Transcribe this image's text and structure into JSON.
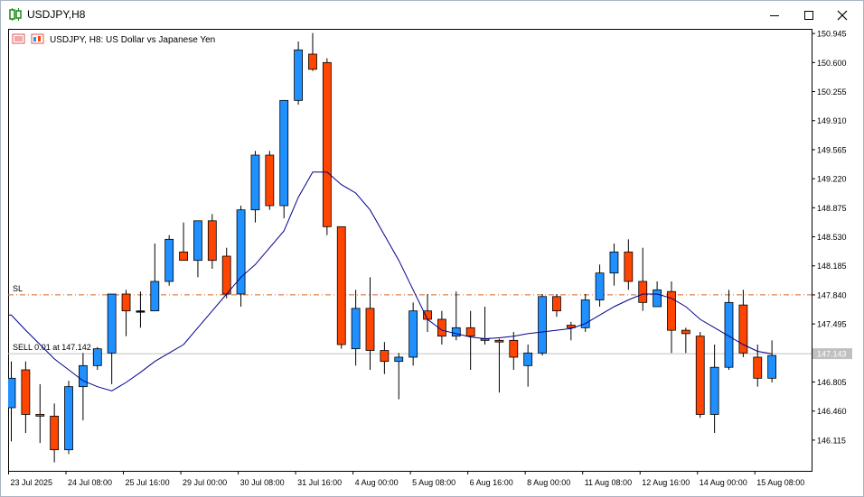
{
  "window": {
    "title": "USDJPY,H8"
  },
  "chart_header": {
    "text": "USDJPY, H8:  US Dollar vs Japanese Yen"
  },
  "levels": {
    "sl_label": "SL",
    "sl_price": 147.84,
    "sell_label": "SELL 0.01 at 147.142",
    "sell_price": 147.142,
    "current_price_label": "147.143"
  },
  "colors": {
    "bull": "#1e90ff",
    "bear": "#ff4500",
    "ma": "#00008b",
    "sl_line": "#d26a2a",
    "sell_line": "#c0c0c0"
  },
  "chart_data": {
    "type": "candlestick",
    "ylim": [
      145.75,
      151.0
    ],
    "y_ticks": [
      "150.945",
      "150.600",
      "150.255",
      "149.910",
      "149.565",
      "149.220",
      "148.875",
      "148.530",
      "148.185",
      "147.840",
      "147.495",
      "146.805",
      "146.460",
      "146.115"
    ],
    "x_ticks": [
      {
        "label": "23 Jul 2025",
        "index": 0
      },
      {
        "label": "24 Jul 08:00",
        "index": 4
      },
      {
        "label": "25 Jul 16:00",
        "index": 8
      },
      {
        "label": "29 Jul 00:00",
        "index": 12
      },
      {
        "label": "30 Jul 08:00",
        "index": 16
      },
      {
        "label": "31 Jul 16:00",
        "index": 20
      },
      {
        "label": "4 Aug 00:00",
        "index": 24
      },
      {
        "label": "5 Aug 08:00",
        "index": 28
      },
      {
        "label": "6 Aug 16:00",
        "index": 32
      },
      {
        "label": "8 Aug 00:00",
        "index": 36
      },
      {
        "label": "11 Aug 08:00",
        "index": 40
      },
      {
        "label": "12 Aug 16:00",
        "index": 44
      },
      {
        "label": "14 Aug 00:00",
        "index": 48
      },
      {
        "label": "15 Aug 08:00",
        "index": 52
      }
    ],
    "candles": [
      {
        "o": 146.5,
        "h": 147.05,
        "l": 146.1,
        "c": 146.85
      },
      {
        "o": 146.95,
        "h": 147.05,
        "l": 146.2,
        "c": 146.42
      },
      {
        "o": 146.42,
        "h": 146.78,
        "l": 146.08,
        "c": 146.4
      },
      {
        "o": 146.4,
        "h": 146.55,
        "l": 145.85,
        "c": 146.0
      },
      {
        "o": 146.0,
        "h": 146.82,
        "l": 145.95,
        "c": 146.75
      },
      {
        "o": 146.75,
        "h": 147.15,
        "l": 146.35,
        "c": 147.0
      },
      {
        "o": 147.0,
        "h": 147.22,
        "l": 146.95,
        "c": 147.2
      },
      {
        "o": 147.15,
        "h": 147.85,
        "l": 146.78,
        "c": 147.85
      },
      {
        "o": 147.85,
        "h": 147.9,
        "l": 147.35,
        "c": 147.65
      },
      {
        "o": 147.65,
        "h": 147.88,
        "l": 147.45,
        "c": 147.65
      },
      {
        "o": 147.65,
        "h": 148.45,
        "l": 147.65,
        "c": 148.0
      },
      {
        "o": 148.0,
        "h": 148.55,
        "l": 147.95,
        "c": 148.5
      },
      {
        "o": 148.35,
        "h": 148.7,
        "l": 148.25,
        "c": 148.25
      },
      {
        "o": 148.25,
        "h": 148.7,
        "l": 148.05,
        "c": 148.72
      },
      {
        "o": 148.72,
        "h": 148.8,
        "l": 148.15,
        "c": 148.25
      },
      {
        "o": 148.3,
        "h": 148.4,
        "l": 147.8,
        "c": 147.85
      },
      {
        "o": 147.85,
        "h": 148.9,
        "l": 147.7,
        "c": 148.85
      },
      {
        "o": 148.85,
        "h": 149.55,
        "l": 148.7,
        "c": 149.5
      },
      {
        "o": 149.5,
        "h": 149.55,
        "l": 148.85,
        "c": 148.9
      },
      {
        "o": 148.9,
        "h": 150.15,
        "l": 148.75,
        "c": 150.15
      },
      {
        "o": 150.15,
        "h": 150.85,
        "l": 150.1,
        "c": 150.75
      },
      {
        "o": 150.7,
        "h": 150.95,
        "l": 150.5,
        "c": 150.52
      },
      {
        "o": 150.6,
        "h": 150.65,
        "l": 148.55,
        "c": 148.65
      },
      {
        "o": 148.65,
        "h": 148.65,
        "l": 147.2,
        "c": 147.25
      },
      {
        "o": 147.2,
        "h": 147.9,
        "l": 147.0,
        "c": 147.68
      },
      {
        "o": 147.68,
        "h": 148.05,
        "l": 146.95,
        "c": 147.18
      },
      {
        "o": 147.18,
        "h": 147.28,
        "l": 146.9,
        "c": 147.05
      },
      {
        "o": 147.05,
        "h": 147.15,
        "l": 146.6,
        "c": 147.1
      },
      {
        "o": 147.1,
        "h": 147.75,
        "l": 147.0,
        "c": 147.65
      },
      {
        "o": 147.65,
        "h": 147.85,
        "l": 147.4,
        "c": 147.55
      },
      {
        "o": 147.55,
        "h": 147.65,
        "l": 147.25,
        "c": 147.35
      },
      {
        "o": 147.35,
        "h": 147.88,
        "l": 147.3,
        "c": 147.45
      },
      {
        "o": 147.45,
        "h": 147.65,
        "l": 146.95,
        "c": 147.35
      },
      {
        "o": 147.32,
        "h": 147.7,
        "l": 147.25,
        "c": 147.3
      },
      {
        "o": 147.3,
        "h": 147.32,
        "l": 146.68,
        "c": 147.28
      },
      {
        "o": 147.3,
        "h": 147.4,
        "l": 146.95,
        "c": 147.1
      },
      {
        "o": 147.0,
        "h": 147.25,
        "l": 146.75,
        "c": 147.15
      },
      {
        "o": 147.15,
        "h": 147.85,
        "l": 147.12,
        "c": 147.82
      },
      {
        "o": 147.82,
        "h": 147.85,
        "l": 147.58,
        "c": 147.65
      },
      {
        "o": 147.48,
        "h": 147.52,
        "l": 147.3,
        "c": 147.45
      },
      {
        "o": 147.45,
        "h": 147.85,
        "l": 147.4,
        "c": 147.78
      },
      {
        "o": 147.78,
        "h": 148.2,
        "l": 147.7,
        "c": 148.1
      },
      {
        "o": 148.1,
        "h": 148.45,
        "l": 147.95,
        "c": 148.35
      },
      {
        "o": 148.35,
        "h": 148.5,
        "l": 147.9,
        "c": 148.0
      },
      {
        "o": 148.0,
        "h": 148.4,
        "l": 147.65,
        "c": 147.75
      },
      {
        "o": 147.7,
        "h": 148.0,
        "l": 147.7,
        "c": 147.9
      },
      {
        "o": 147.88,
        "h": 148.0,
        "l": 147.15,
        "c": 147.42
      },
      {
        "o": 147.42,
        "h": 147.45,
        "l": 147.15,
        "c": 147.38
      },
      {
        "o": 147.35,
        "h": 147.4,
        "l": 146.38,
        "c": 146.42
      },
      {
        "o": 146.42,
        "h": 147.25,
        "l": 146.2,
        "c": 146.98
      },
      {
        "o": 146.98,
        "h": 147.9,
        "l": 146.95,
        "c": 147.75
      },
      {
        "o": 147.72,
        "h": 147.9,
        "l": 147.1,
        "c": 147.15
      },
      {
        "o": 147.1,
        "h": 147.25,
        "l": 146.75,
        "c": 146.85
      },
      {
        "o": 146.85,
        "h": 147.3,
        "l": 146.8,
        "c": 147.12
      }
    ],
    "moving_average": [
      147.6,
      147.42,
      147.25,
      147.08,
      146.95,
      146.82,
      146.75,
      146.7,
      146.8,
      146.92,
      147.05,
      147.15,
      147.25,
      147.45,
      147.65,
      147.85,
      148.05,
      148.2,
      148.4,
      148.6,
      149.0,
      149.3,
      149.3,
      149.15,
      149.05,
      148.85,
      148.55,
      148.25,
      147.9,
      147.55,
      147.42,
      147.38,
      147.34,
      147.32,
      147.33,
      147.35,
      147.38,
      147.4,
      147.42,
      147.44,
      147.5,
      147.6,
      147.7,
      147.78,
      147.85,
      147.85,
      147.8,
      147.7,
      147.55,
      147.45,
      147.35,
      147.25,
      147.17,
      147.14
    ]
  }
}
